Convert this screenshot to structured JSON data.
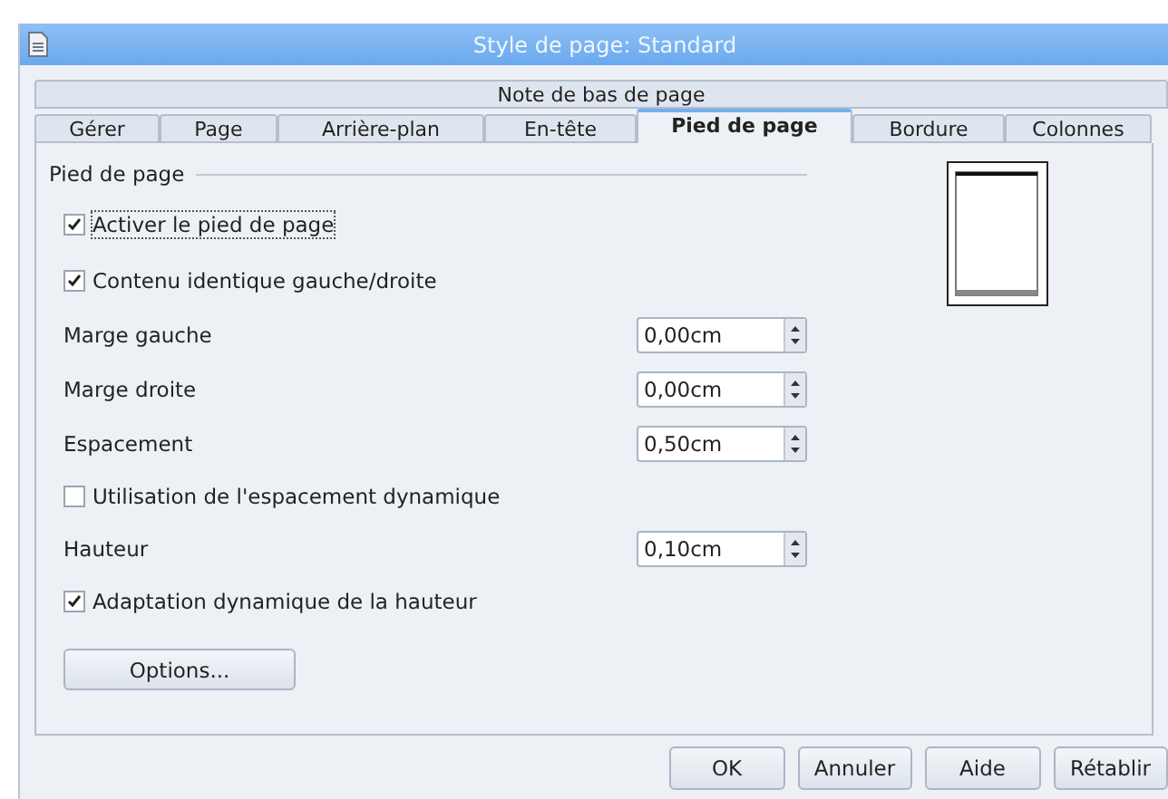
{
  "window": {
    "title": "Style de page: Standard"
  },
  "tab_rows": [
    [
      {
        "label": "Note de bas de page",
        "selected": false
      }
    ],
    [
      {
        "label": "Gérer",
        "selected": false
      },
      {
        "label": "Page",
        "selected": false
      },
      {
        "label": "Arrière-plan",
        "selected": false
      },
      {
        "label": "En-tête",
        "selected": false
      },
      {
        "label": "Pied de page",
        "selected": true
      },
      {
        "label": "Bordure",
        "selected": false
      },
      {
        "label": "Colonnes",
        "selected": false
      }
    ]
  ],
  "group": {
    "title": "Pied de page"
  },
  "fields": [
    {
      "kind": "checkbox",
      "label": "Activer le pied de page",
      "checked": true,
      "focused": true
    },
    {
      "kind": "checkbox",
      "label": "Contenu identique gauche/droite",
      "checked": true,
      "focused": false
    },
    {
      "kind": "spin",
      "label": "Marge gauche",
      "value": "0,00cm"
    },
    {
      "kind": "spin",
      "label": "Marge droite",
      "value": "0,00cm"
    },
    {
      "kind": "spin",
      "label": "Espacement",
      "value": "0,50cm"
    },
    {
      "kind": "checkbox",
      "label": "Utilisation de l'espacement dynamique",
      "checked": false,
      "focused": false
    },
    {
      "kind": "spin",
      "label": "Hauteur",
      "value": "0,10cm"
    },
    {
      "kind": "checkbox",
      "label": "Adaptation dynamique de la hauteur",
      "checked": true,
      "focused": false
    }
  ],
  "options_button": "Options...",
  "buttons": [
    "OK",
    "Annuler",
    "Aide",
    "Rétablir"
  ]
}
